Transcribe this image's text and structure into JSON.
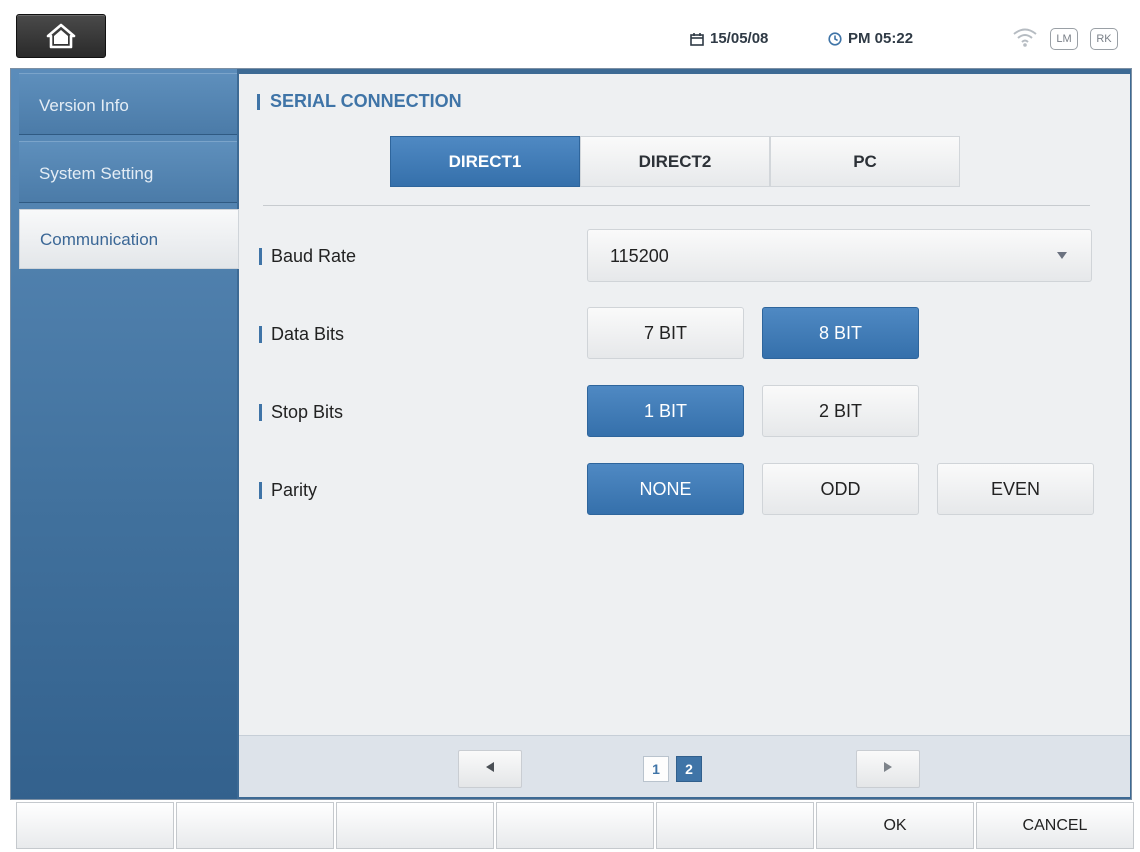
{
  "status": {
    "date": "15/05/08",
    "time": "PM 05:22",
    "badges": [
      "LM",
      "RK"
    ]
  },
  "sidebar": {
    "items": [
      {
        "label": "Version Info",
        "active": false
      },
      {
        "label": "System Setting",
        "active": false
      },
      {
        "label": "Communication",
        "active": true
      }
    ]
  },
  "section": {
    "title": "SERIAL CONNECTION",
    "tabs": [
      {
        "label": "DIRECT1",
        "selected": true
      },
      {
        "label": "DIRECT2",
        "selected": false
      },
      {
        "label": "PC",
        "selected": false
      }
    ]
  },
  "settings": {
    "baud_rate": {
      "label": "Baud Rate",
      "value": "115200"
    },
    "data_bits": {
      "label": "Data Bits",
      "options": [
        "7 BIT",
        "8 BIT"
      ],
      "selected": "8 BIT"
    },
    "stop_bits": {
      "label": "Stop Bits",
      "options": [
        "1 BIT",
        "2 BIT"
      ],
      "selected": "1 BIT"
    },
    "parity": {
      "label": "Parity",
      "options": [
        "NONE",
        "ODD",
        "EVEN"
      ],
      "selected": "NONE"
    }
  },
  "pager": {
    "pages": [
      "1",
      "2"
    ],
    "current": "2"
  },
  "softkeys": [
    "",
    "",
    "",
    "",
    "",
    "OK",
    "CANCEL"
  ],
  "colors": {
    "accent": "#3f74a7",
    "selected": "#3570ab",
    "sidebar": "#41719d"
  }
}
